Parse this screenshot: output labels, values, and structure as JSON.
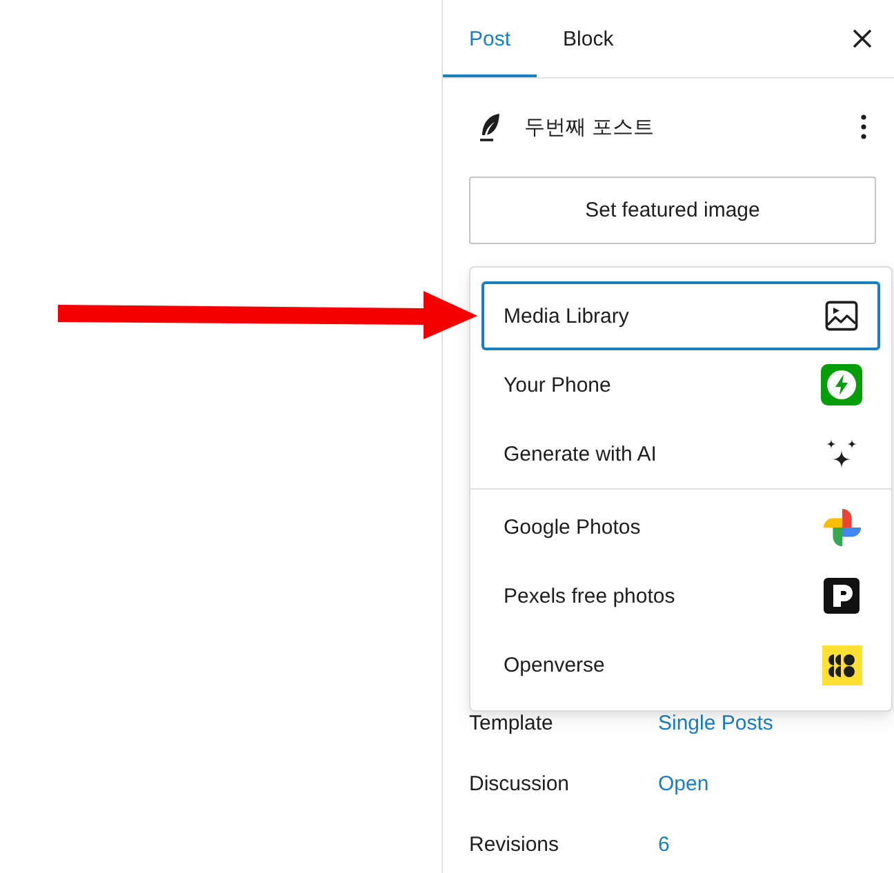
{
  "sidebar": {
    "tabs": [
      {
        "label": "Post",
        "selected": true
      },
      {
        "label": "Block",
        "selected": false
      }
    ],
    "post": {
      "title": "두번째 포스트"
    },
    "featured_image": {
      "button": "Set featured image",
      "menu": {
        "groups": [
          {
            "items": [
              {
                "label": "Media Library",
                "kind": "media-library",
                "selected": true
              },
              {
                "label": "Your Phone",
                "kind": "phone",
                "selected": false
              },
              {
                "label": "Generate with AI",
                "kind": "ai",
                "selected": false
              }
            ]
          },
          {
            "items": [
              {
                "label": "Google Photos",
                "kind": "google-photos",
                "selected": false
              },
              {
                "label": "Pexels free photos",
                "kind": "pexels",
                "selected": false
              },
              {
                "label": "Openverse",
                "kind": "openverse",
                "selected": false
              }
            ]
          }
        ]
      }
    },
    "settings": [
      {
        "label": "Template",
        "value": "Single Posts"
      },
      {
        "label": "Discussion",
        "value": "Open"
      },
      {
        "label": "Revisions",
        "value": "6"
      }
    ]
  }
}
